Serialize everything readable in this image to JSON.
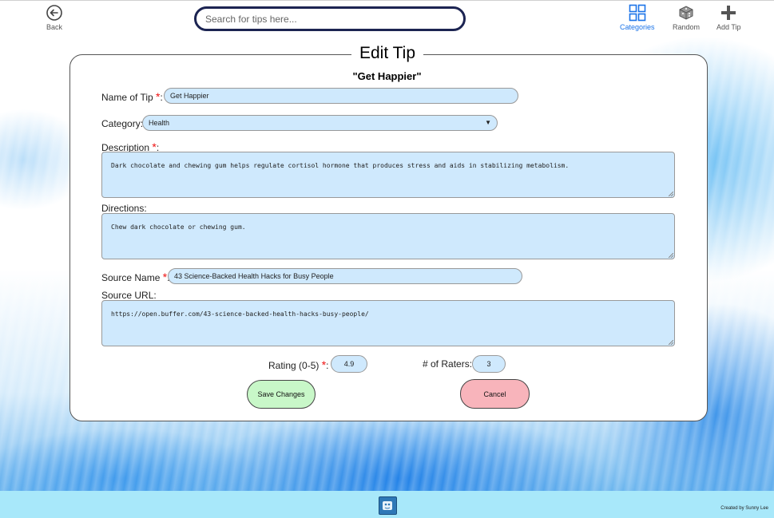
{
  "header": {
    "back_label": "Back",
    "search_placeholder": "Search for tips here...",
    "categories_label": "Categories",
    "random_label": "Random",
    "add_tip_label": "Add Tip"
  },
  "form": {
    "title": "Edit Tip",
    "subtitle": "\"Get Happier\"",
    "name_label": "Name of Tip",
    "name_value": "Get Happier",
    "category_label": "Category:",
    "category_value": "Health",
    "description_label": "Description",
    "description_value": "Dark chocolate and chewing gum helps regulate cortisol hormone that produces stress and aids in stabilizing metabolism.",
    "directions_label": "Directions:",
    "directions_value": "Chew dark chocolate or chewing gum.",
    "source_name_label": "Source Name",
    "source_name_value": "43 Science-Backed Health Hacks for Busy People",
    "source_url_label": "Source URL:",
    "source_url_value": "https://open.buffer.com/43-science-backed-health-hacks-busy-people/",
    "rating_label": "Rating (0-5)",
    "rating_value": "4.9",
    "raters_label": "# of Raters:",
    "raters_value": "3",
    "required_mark": "*",
    "colon": ":",
    "save_label": "Save Changes",
    "cancel_label": "Cancel"
  },
  "footer": {
    "credit": "Created by Sunny Lee"
  },
  "colors": {
    "field_bg": "#cfe9fd",
    "save_bg": "#c8f7c8",
    "cancel_bg": "#f8b4bb",
    "accent": "#1a73e8",
    "footer_bg": "#a8e8fa"
  },
  "icons": {
    "back": "arrow-left-circle-icon",
    "categories": "grid-icon",
    "random": "dice-icon",
    "add_tip": "plus-icon",
    "footer_logo": "app-logo-icon"
  }
}
